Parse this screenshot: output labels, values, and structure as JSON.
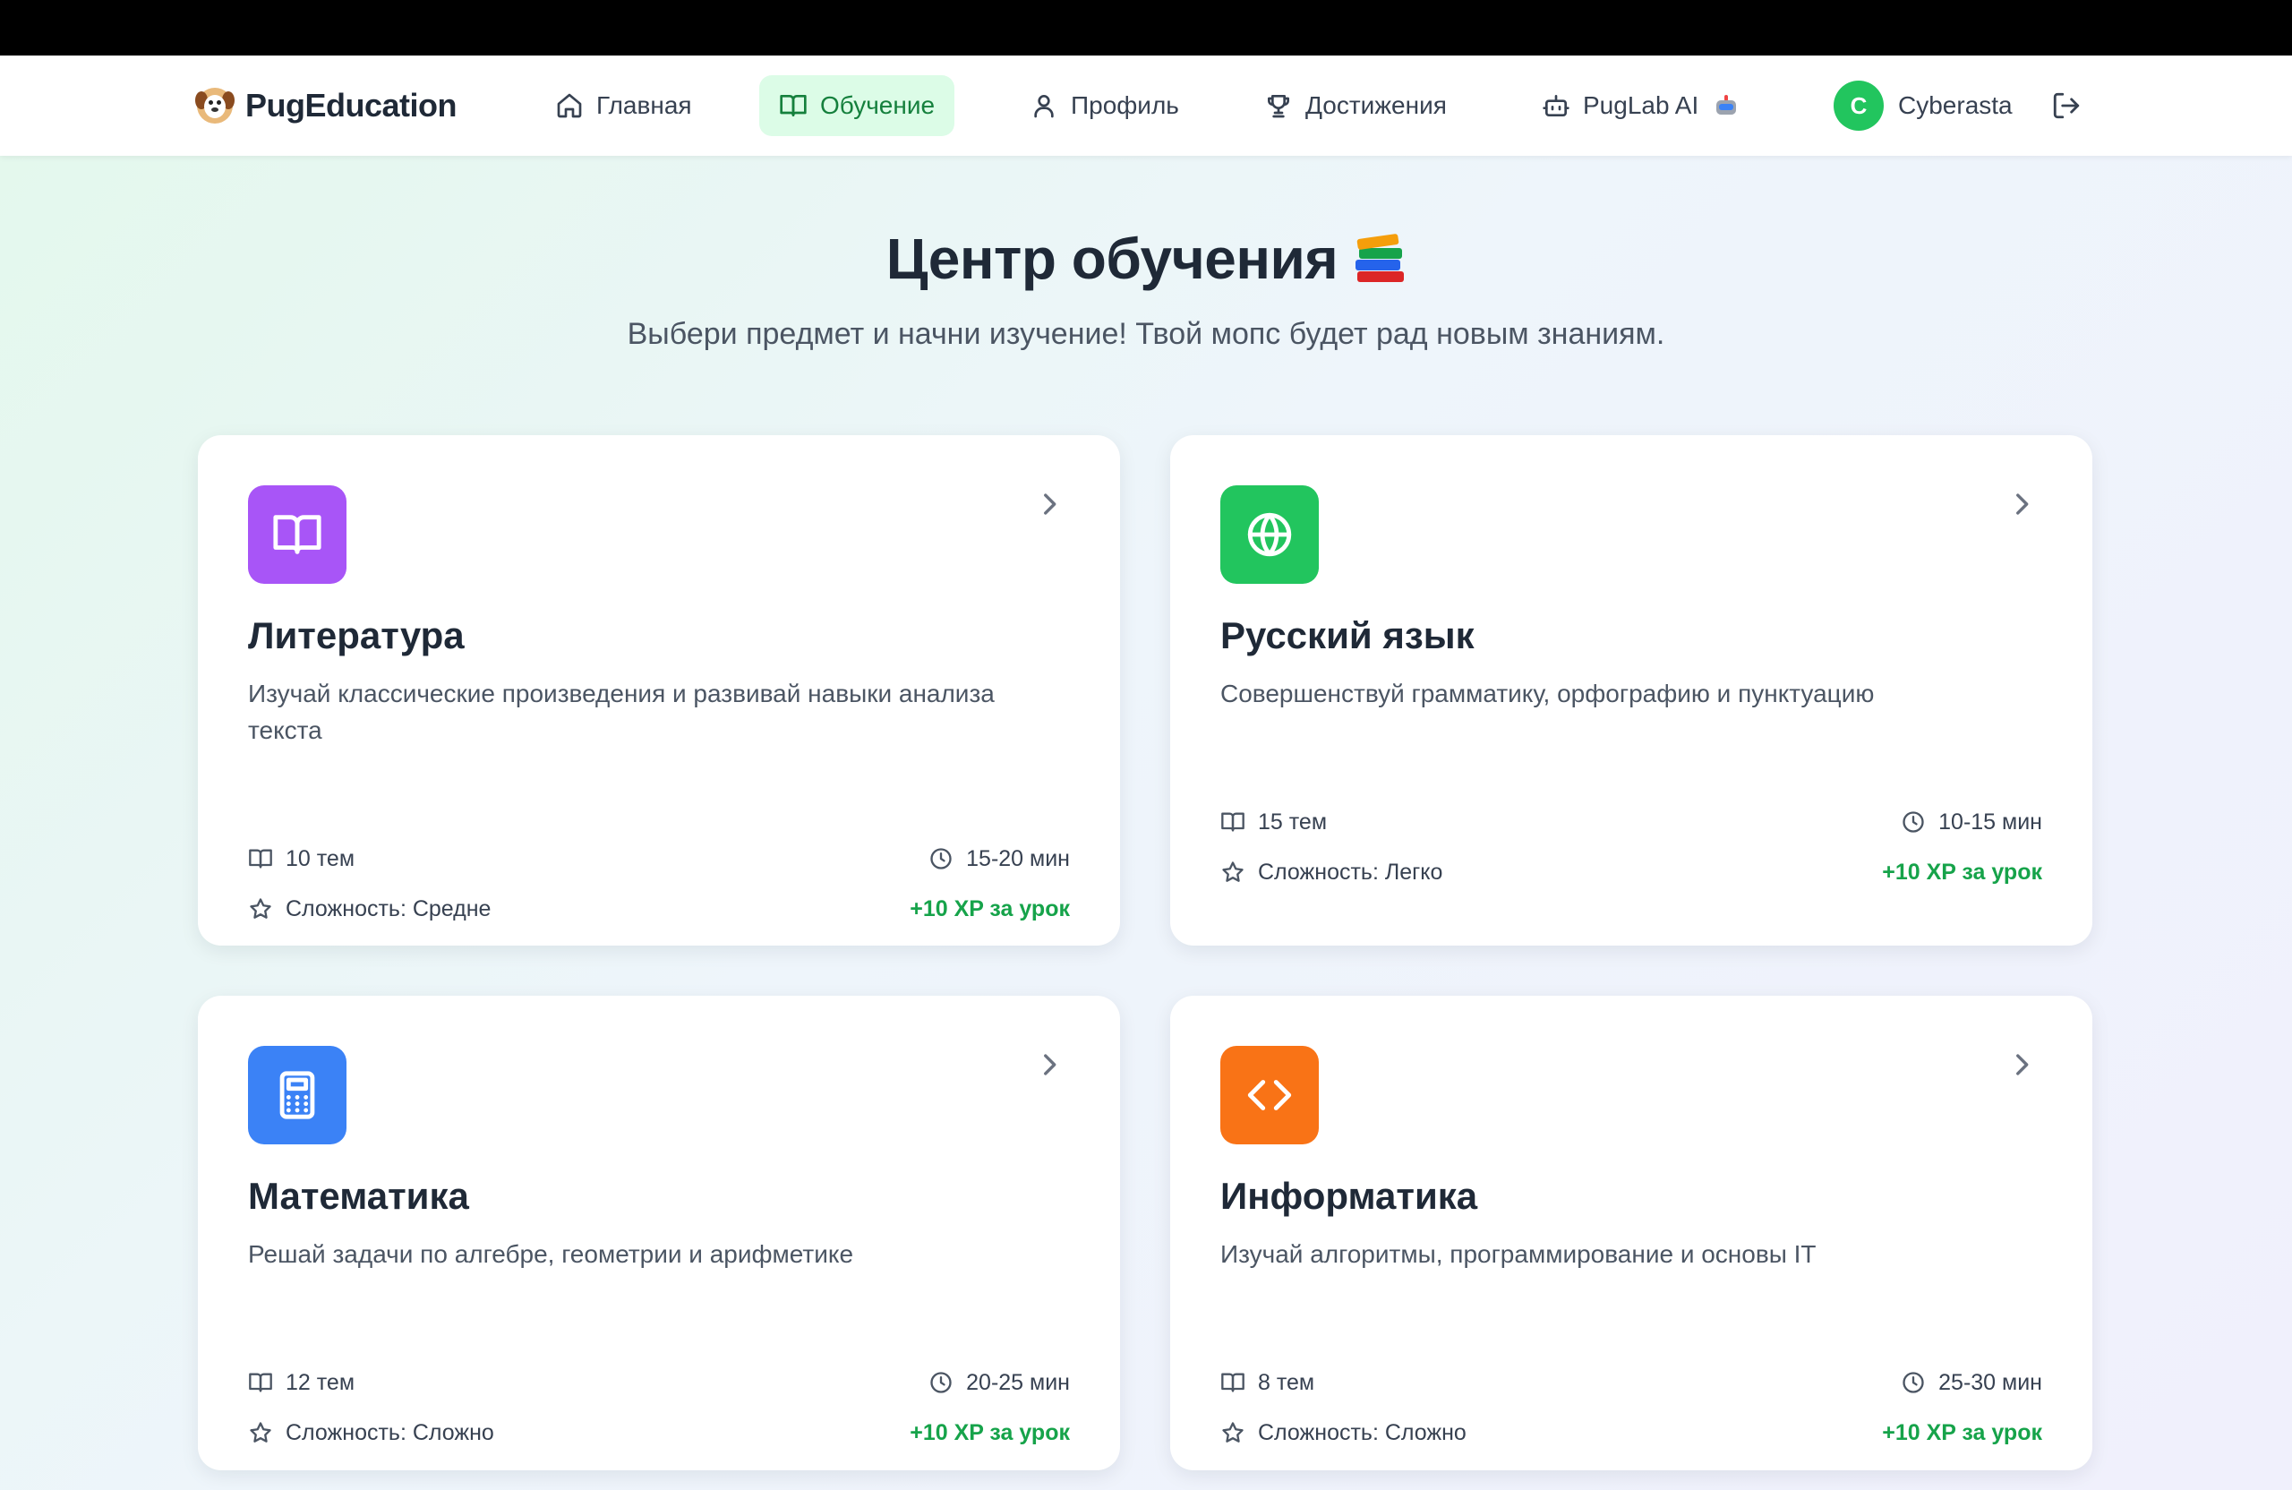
{
  "nav": {
    "brand": "PugEducation",
    "items": [
      {
        "label": "Главная",
        "icon": "home-icon"
      },
      {
        "label": "Обучение",
        "icon": "book-open-icon",
        "active": true
      },
      {
        "label": "Профиль",
        "icon": "user-icon"
      },
      {
        "label": "Достижения",
        "icon": "trophy-icon"
      },
      {
        "label": "PugLab AI",
        "icon": "bot-icon"
      }
    ],
    "user": {
      "initial": "C",
      "name": "Cyberasta"
    }
  },
  "hero": {
    "title": "Центр обучения",
    "subtitle": "Выбери предмет и начни изучение! Твой мопс будет рад новым знаниям."
  },
  "subjects": [
    {
      "title": "Литература",
      "description": "Изучай классические произведения и развивай навыки анализа текста",
      "topics": "10 тем",
      "duration": "15-20 мин",
      "difficulty": "Сложность: Средне",
      "xp": "+10 XP за урок",
      "icon": "book-open-icon",
      "color": "#a855f7"
    },
    {
      "title": "Русский язык",
      "description": "Совершенствуй грамматику, орфографию и пунктуацию",
      "topics": "15 тем",
      "duration": "10-15 мин",
      "difficulty": "Сложность: Легко",
      "xp": "+10 XP за урок",
      "icon": "globe-icon",
      "color": "#22c55e"
    },
    {
      "title": "Математика",
      "description": "Решай задачи по алгебре, геометрии и арифметике",
      "topics": "12 тем",
      "duration": "20-25 мин",
      "difficulty": "Сложность: Сложно",
      "xp": "+10 XP за урок",
      "icon": "calculator-icon",
      "color": "#3b82f6"
    },
    {
      "title": "Информатика",
      "description": "Изучай алгоритмы, программирование и основы IT",
      "topics": "8 тем",
      "duration": "25-30 мин",
      "difficulty": "Сложность: Сложно",
      "xp": "+10 XP за урок",
      "icon": "code-icon",
      "color": "#f97316"
    }
  ],
  "colors": {
    "accent": "#16a34a",
    "active_bg": "#dcfce7"
  }
}
